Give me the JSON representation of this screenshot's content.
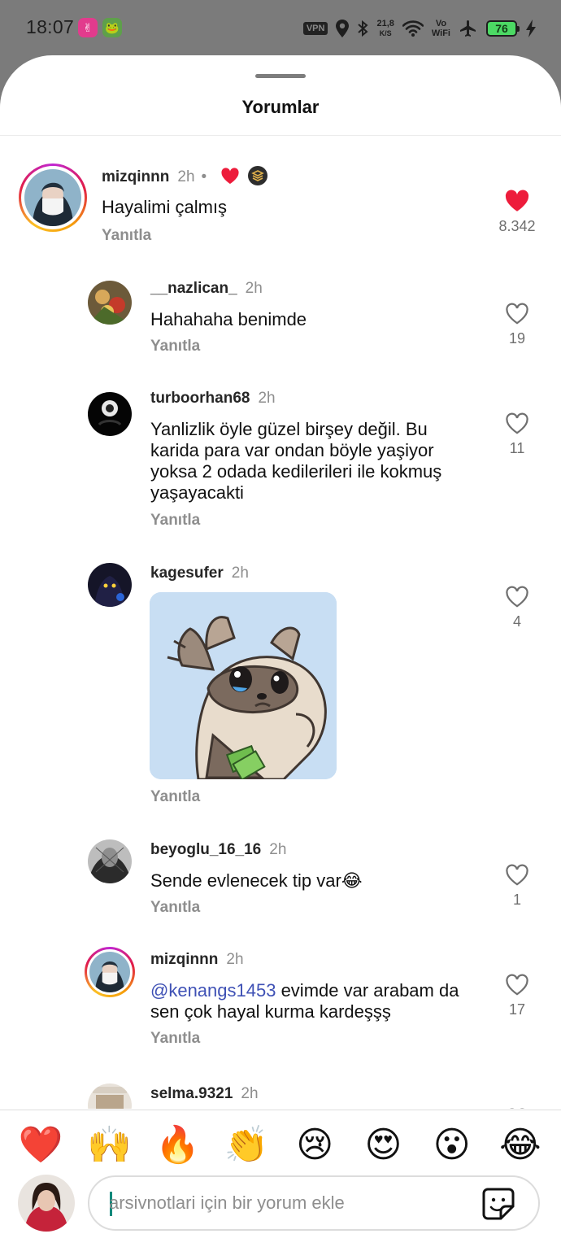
{
  "status_bar": {
    "time": "18:07",
    "vpn": "VPN",
    "net_speed_value": "21,8",
    "net_speed_unit": "K/S",
    "vowifi_top": "Vo",
    "vowifi_bottom": "WiFi",
    "battery": "76"
  },
  "sheet": {
    "title": "Yorumlar"
  },
  "comments": [
    {
      "username": "mizqinnn",
      "time": "2h",
      "text": "Hayalimi çalmış",
      "reply_label": "Yanıtla",
      "likes": "8.342",
      "liked": true
    },
    {
      "username": "__nazlican_",
      "time": "2h",
      "text": "Hahahaha benimde",
      "reply_label": "Yanıtla",
      "likes": "19",
      "liked": false
    },
    {
      "username": "turboorhan68",
      "time": "2h",
      "text": "Yanlizlik öyle güzel birşey değil. Bu karida para var ondan böyle yaşiyor yoksa 2 odada kedilerileri ile kokmuş yaşayacakti",
      "reply_label": "Yanıtla",
      "likes": "11",
      "liked": false
    },
    {
      "username": "kagesufer",
      "time": "2h",
      "text": "",
      "reply_label": "Yanıtla",
      "likes": "4",
      "liked": false
    },
    {
      "username": "beyoglu_16_16",
      "time": "2h",
      "text": "Sende evlenecek tip var😂",
      "reply_label": "Yanıtla",
      "likes": "1",
      "liked": false
    },
    {
      "username": "mizqinnn",
      "time": "2h",
      "mention": "@kenangs1453",
      "text": " evimde var arabam da sen çok hayal kurma kardeşşş",
      "reply_label": "Yanıtla",
      "likes": "17",
      "liked": false
    },
    {
      "username": "selma.9321",
      "time": "2h"
    }
  ],
  "quick_reactions": [
    "❤️",
    "🙌",
    "🔥",
    "👏",
    "😢",
    "😍",
    "😮",
    "😂"
  ],
  "composer": {
    "placeholder": "arsivnotlari için bir yorum ekle"
  },
  "colors": {
    "like_active": "#ed1c3b",
    "mention": "#3f51b5",
    "sheet_bg": "#ffffff",
    "scrim": "#7b7b7b"
  }
}
